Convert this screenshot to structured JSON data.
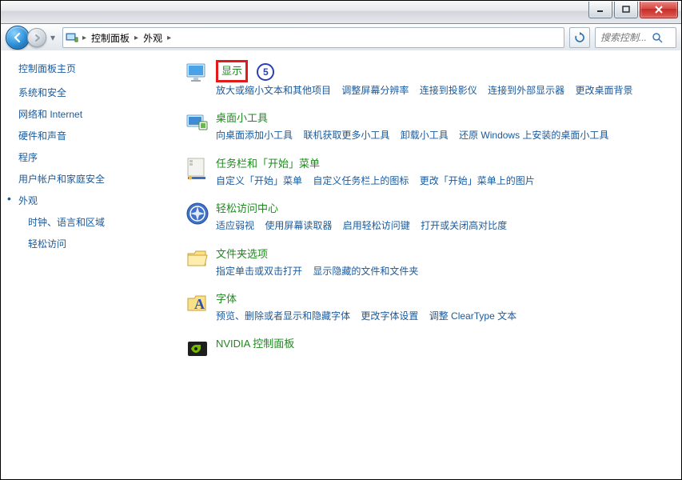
{
  "breadcrumb": {
    "root_sep": "▸",
    "item1": "控制面板",
    "item2": "外观"
  },
  "search": {
    "placeholder": "搜索控制..."
  },
  "annotation": {
    "number": "5"
  },
  "sidebar": {
    "title": "控制面板主页",
    "items": [
      {
        "label": "系统和安全"
      },
      {
        "label": "网络和 Internet"
      },
      {
        "label": "硬件和声音"
      },
      {
        "label": "程序"
      },
      {
        "label": "用户帐户和家庭安全"
      },
      {
        "label": "外观"
      },
      {
        "label": "时钟、语言和区域"
      },
      {
        "label": "轻松访问"
      }
    ]
  },
  "categories": [
    {
      "title": "显示",
      "links": [
        "放大或缩小文本和其他项目",
        "调整屏幕分辨率",
        "连接到投影仪",
        "连接到外部显示器",
        "更改桌面背景"
      ]
    },
    {
      "title": "桌面小工具",
      "links": [
        "向桌面添加小工具",
        "联机获取更多小工具",
        "卸载小工具",
        "还原 Windows 上安装的桌面小工具"
      ]
    },
    {
      "title": "任务栏和「开始」菜单",
      "links": [
        "自定义「开始」菜单",
        "自定义任务栏上的图标",
        "更改「开始」菜单上的图片"
      ]
    },
    {
      "title": "轻松访问中心",
      "links": [
        "适应弱视",
        "使用屏幕读取器",
        "启用轻松访问键",
        "打开或关闭高对比度"
      ]
    },
    {
      "title": "文件夹选项",
      "links": [
        "指定单击或双击打开",
        "显示隐藏的文件和文件夹"
      ]
    },
    {
      "title": "字体",
      "links": [
        "预览、删除或者显示和隐藏字体",
        "更改字体设置",
        "调整 ClearType 文本"
      ]
    },
    {
      "title": "NVIDIA 控制面板",
      "links": []
    }
  ]
}
